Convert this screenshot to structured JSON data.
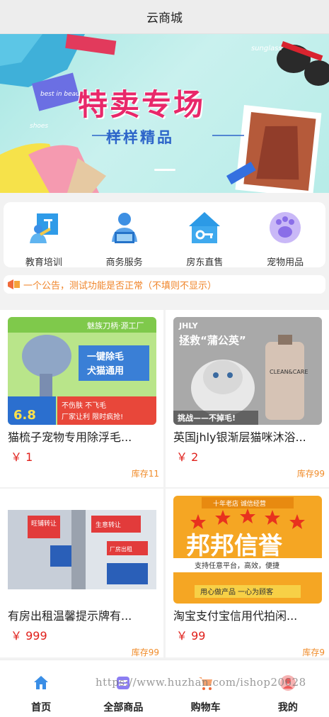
{
  "header": {
    "title": "云商城"
  },
  "banner": {
    "headline": "特卖专场",
    "subheadline": "样样精品",
    "tags": [
      "best in beauty",
      "shoes",
      "sunglass"
    ]
  },
  "categories": [
    {
      "label": "教育培训",
      "icon": "education-icon",
      "color": "#2f9be8"
    },
    {
      "label": "商务服务",
      "icon": "business-person-icon",
      "color": "#3d8fe3"
    },
    {
      "label": "房东直售",
      "icon": "house-key-icon",
      "color": "#2c9ae6"
    },
    {
      "label": "宠物用品",
      "icon": "paw-icon",
      "color": "#a88ef0"
    }
  ],
  "notice": {
    "icon": "announcement-icon",
    "text": "一个公告，测试功能是否正常（不填则不显示）"
  },
  "products": [
    {
      "name": "猫梳子宠物专用除浮毛...",
      "price": "￥ 1",
      "stock": "库存11",
      "image_text": [
        "魅族刀柄·源工厂",
        "一键除毛",
        "犬猫通用",
        "不伤肤 不飞毛",
        "厂家让利 限时疯抢!",
        "6.8"
      ]
    },
    {
      "name": "英国jhly银渐层猫咪沐浴...",
      "price": "￥ 2",
      "stock": "库存99",
      "image_text": [
        "JHLY",
        "拯救“蒲公英”",
        "CLEAN&CARE",
        "挑战——不掉毛!"
      ]
    },
    {
      "name": "有房出租温馨提示牌有...",
      "price": "￥ 999",
      "stock": "库存99",
      "image_text": [
        "旺铺转让",
        "生意转让",
        "厂房出租"
      ]
    },
    {
      "name": "淘宝支付宝信用代拍闲...",
      "price": "￥ 99",
      "stock": "库存9",
      "image_text": [
        "十年老店 诚信经营",
        "邦邦信誉",
        "支持任意平台，高效，便捷",
        "用心做产品 一心为顾客"
      ]
    }
  ],
  "tabbar": [
    {
      "label": "首页",
      "icon": "home-icon",
      "color": "#3a8ee6"
    },
    {
      "label": "全部商品",
      "icon": "grid-icon",
      "color": "#7a6cf0"
    },
    {
      "label": "购物车",
      "icon": "cart-icon",
      "color": "#f06a3a"
    },
    {
      "label": "我的",
      "icon": "user-icon",
      "color": "#f05a5a"
    }
  ],
  "watermark": "https://www.huzhan.com/ishop20628"
}
